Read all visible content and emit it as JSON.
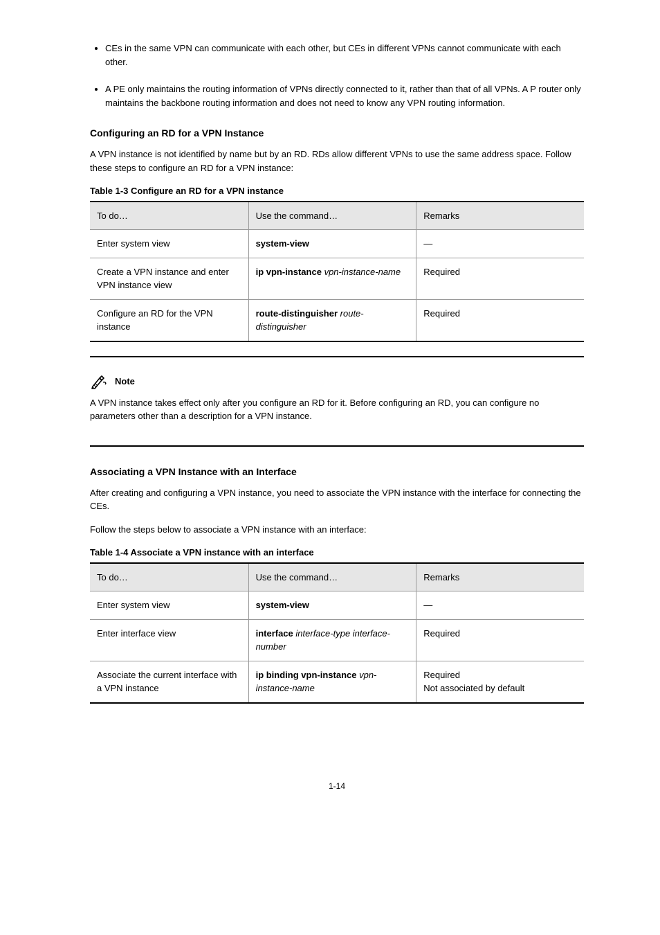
{
  "bullets": [
    "CEs in the same VPN can communicate with each other, but CEs in different VPNs cannot communicate with each other.",
    "A PE only maintains the routing information of VPNs directly connected to it, rather than that of all VPNs. A P router only maintains the backbone routing information and does not need to know any VPN routing information."
  ],
  "sections": {
    "configure_rd": {
      "heading": "Configuring an RD for a VPN Instance",
      "body": "A VPN instance is not identified by name but by an RD. RDs allow different VPNs to use the same address space. Follow these steps to configure an RD for a VPN instance:",
      "table_caption": "Table 1-3 Configure an RD for a VPN instance",
      "table": {
        "headers": [
          "To do…",
          "Use the command…",
          "Remarks"
        ],
        "rows": [
          [
            "Enter system view",
            "system-view",
            "—"
          ],
          [
            "Create a VPN instance and enter VPN instance view",
            "ip vpn-instance vpn-instance-name",
            "Required"
          ],
          [
            "Configure an RD for the VPN instance",
            "route-distinguisher route-distinguisher",
            "Required"
          ]
        ]
      }
    },
    "note": {
      "label": "Note",
      "text": "A VPN instance takes effect only after you configure an RD for it. Before configuring an RD, you can configure no parameters other than a description for a VPN instance."
    },
    "associate_iface": {
      "heading": "Associating a VPN Instance with an Interface",
      "para1": "After creating and configuring a VPN instance, you need to associate the VPN instance with the interface for connecting the CEs.",
      "para2": "Follow the steps below to associate a VPN instance with an interface:",
      "table_caption": "Table 1-4 Associate a VPN instance with an interface",
      "table": {
        "headers": [
          "To do…",
          "Use the command…",
          "Remarks"
        ],
        "rows": [
          [
            "Enter system view",
            "system-view",
            "—"
          ],
          [
            "Enter interface view",
            "interface interface-type interface-number",
            "Required"
          ],
          [
            "Associate the current interface with a VPN instance",
            "ip binding vpn-instance vpn-instance-name",
            "Required\nNot associated by default"
          ]
        ]
      }
    }
  },
  "page_number": "1-14"
}
